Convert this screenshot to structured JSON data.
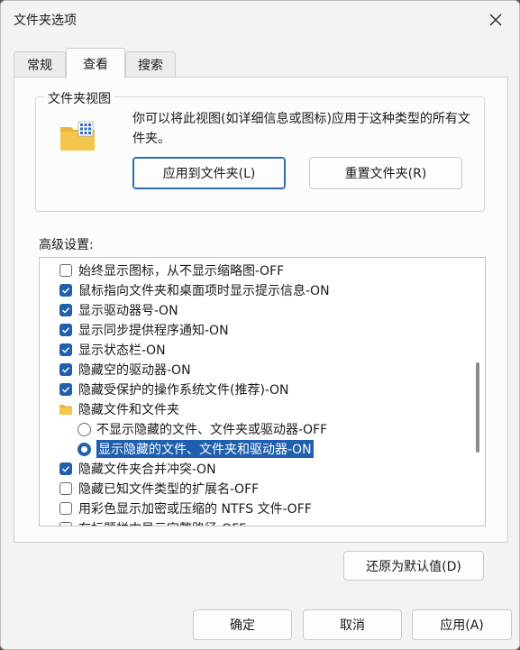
{
  "window": {
    "title": "文件夹选项"
  },
  "tabs": [
    {
      "label": "常规"
    },
    {
      "label": "查看"
    },
    {
      "label": "搜索"
    }
  ],
  "folder_views": {
    "group_label": "文件夹视图",
    "description": "你可以将此视图(如详细信息或图标)应用于这种类型的所有文件夹。",
    "apply_label": "应用到文件夹(L)",
    "reset_label": "重置文件夹(R)"
  },
  "advanced": {
    "label": "高级设置:",
    "items": [
      {
        "type": "checkbox",
        "checked": false,
        "label": "始终显示图标，从不显示缩略图-OFF"
      },
      {
        "type": "checkbox",
        "checked": true,
        "label": "鼠标指向文件夹和桌面项时显示提示信息-ON"
      },
      {
        "type": "checkbox",
        "checked": true,
        "label": "显示驱动器号-ON"
      },
      {
        "type": "checkbox",
        "checked": true,
        "label": "显示同步提供程序通知-ON"
      },
      {
        "type": "checkbox",
        "checked": true,
        "label": "显示状态栏-ON"
      },
      {
        "type": "checkbox",
        "checked": true,
        "label": "隐藏空的驱动器-ON"
      },
      {
        "type": "checkbox",
        "checked": true,
        "label": "隐藏受保护的操作系统文件(推荐)-ON"
      },
      {
        "type": "folder",
        "label": "隐藏文件和文件夹"
      },
      {
        "type": "radio",
        "checked": false,
        "label": "不显示隐藏的文件、文件夹或驱动器-OFF"
      },
      {
        "type": "radio",
        "checked": true,
        "label": "显示隐藏的文件、文件夹和驱动器-ON"
      },
      {
        "type": "checkbox",
        "checked": true,
        "label": "隐藏文件夹合并冲突-ON"
      },
      {
        "type": "checkbox",
        "checked": false,
        "label": "隐藏已知文件类型的扩展名-OFF"
      },
      {
        "type": "checkbox",
        "checked": false,
        "label": "用彩色显示加密或压缩的 NTFS 文件-OFF"
      },
      {
        "type": "checkbox",
        "checked": false,
        "label": "在标题栏中显示完整路径-OFF"
      }
    ],
    "restore_label": "还原为默认值(D)"
  },
  "footer": {
    "ok_label": "确定",
    "cancel_label": "取消",
    "apply_label": "应用(A)"
  },
  "colors": {
    "accent": "#1f5fad",
    "folder": "#f4c54a"
  },
  "icons": {
    "close": "close-icon",
    "folder_view": "folder-view-icon",
    "checkbox_check": "check-icon",
    "small_folder": "folder-icon"
  }
}
